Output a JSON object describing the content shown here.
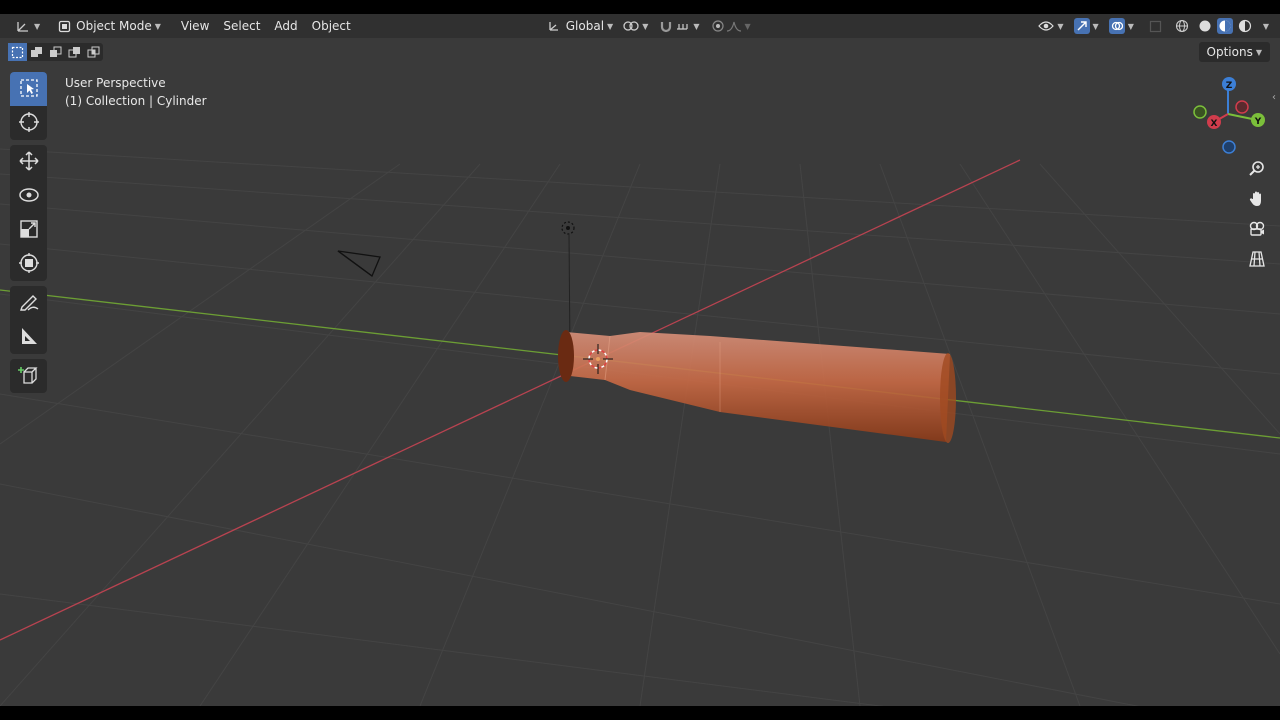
{
  "header": {
    "mode_label": "Object Mode",
    "menus": [
      "View",
      "Select",
      "Add",
      "Object"
    ],
    "transform_orientation": "Global"
  },
  "subbar": {
    "options_label": "Options"
  },
  "overlay": {
    "view_name": "User Perspective",
    "collection": "(1) Collection | Cylinder"
  },
  "gizmo": {
    "x": "X",
    "y": "Y",
    "z": "Z"
  },
  "colors": {
    "accent": "#4772b3",
    "x_axis": "#d03c4c",
    "y_axis": "#7bbf3a",
    "z_axis": "#3c7fd6",
    "bottle": "#c0603a"
  },
  "icons": {
    "editor_type": "axes-icon",
    "mode": "object-mode-icon",
    "pivot": "transform-pivot-icon",
    "snap": "magnet-icon",
    "proportional": "proportional-edit-icon",
    "visibility": "eye-icon",
    "gizmo_toggle": "gizmo-icon",
    "overlays": "overlays-icon",
    "xray": "xray-icon",
    "shading": [
      "wireframe-icon",
      "solid-icon",
      "material-icon",
      "rendered-icon"
    ],
    "tools": [
      "select-box-icon",
      "cursor-icon",
      "move-icon",
      "rotate-icon",
      "scale-icon",
      "transform-icon",
      "annotate-icon",
      "measure-icon",
      "add-cube-icon"
    ],
    "nav": [
      "zoom-icon",
      "pan-hand-icon",
      "camera-icon",
      "ortho-grid-icon"
    ]
  }
}
